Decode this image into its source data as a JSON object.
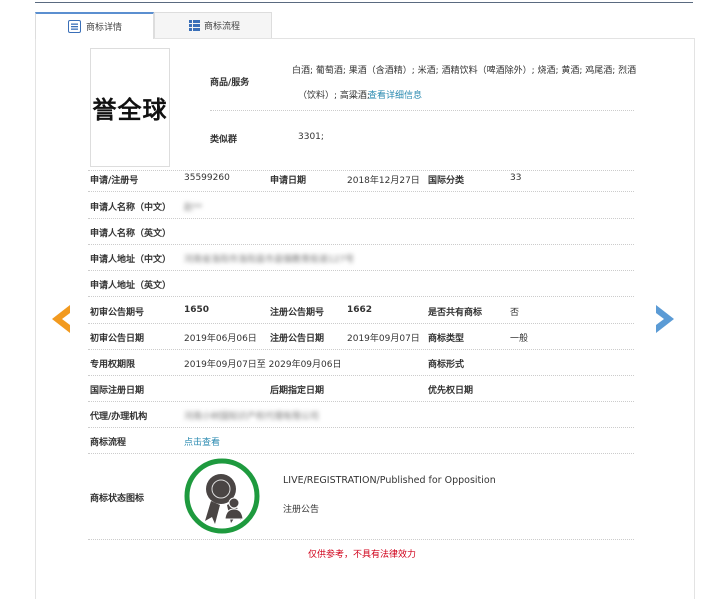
{
  "tabs": [
    {
      "label": "商标详情",
      "icon": "document-icon"
    },
    {
      "label": "商标流程",
      "icon": "list-icon"
    }
  ],
  "mark_text": "誉全球",
  "goods": {
    "label": "商品/服务",
    "line1": "白酒; 葡萄酒; 果酒（含酒精）; 米酒; 酒精饮料（啤酒除外）; 烧酒; 黄酒; 鸡尾酒; 烈酒",
    "line2": "（饮料）; 高粱酒;",
    "link": "查看详细信息"
  },
  "similar": {
    "label": "类似群",
    "value": "3301;"
  },
  "rows": {
    "reg_no": {
      "label": "申请/注册号",
      "value": "35599260"
    },
    "app_date": {
      "label": "申请日期",
      "value": "2018年12月27日"
    },
    "intl_class": {
      "label": "国际分类",
      "value": "33"
    },
    "applicant_cn": {
      "label": "申请人名称（中文）",
      "value": "赵**"
    },
    "applicant_en": {
      "label": "申请人名称（英文）"
    },
    "address_cn": {
      "label": "申请人地址（中文）",
      "value": "河南省洛阳市洛阳县市县镇教育街道127号"
    },
    "address_en": {
      "label": "申请人地址（英文）"
    },
    "prelim_no": {
      "label": "初审公告期号",
      "value": "1650"
    },
    "reg_pub_no": {
      "label": "注册公告期号",
      "value": "1662"
    },
    "shared": {
      "label": "是否共有商标",
      "value": "否"
    },
    "prelim_date": {
      "label": "初审公告日期",
      "value": "2019年06月06日"
    },
    "reg_pub_date": {
      "label": "注册公告日期",
      "value": "2019年09月07日"
    },
    "mark_type": {
      "label": "商标类型",
      "value": "一般"
    },
    "exclusive": {
      "label": "专用权期限",
      "value": "2019年09月07日至 2029年09月06日"
    },
    "mark_form": {
      "label": "商标形式"
    },
    "intl_reg_date": {
      "label": "国际注册日期"
    },
    "later_date": {
      "label": "后期指定日期"
    },
    "priority_date": {
      "label": "优先权日期"
    },
    "agent": {
      "label": "代理/办理机构",
      "value": "河南小树国知识产权代理有限公司"
    },
    "flow": {
      "label": "商标流程",
      "link": "点击查看"
    }
  },
  "status": {
    "label": "商标状态图标",
    "en": "LIVE/REGISTRATION/Published for Opposition",
    "cn": "注册公告",
    "icon": "award-ribbon-icon",
    "ring_color": "#1e9a3e"
  },
  "disclaimer": "仅供参考，不具有法律效力",
  "colors": {
    "prev_arrow": "#f29a1f",
    "next_arrow": "#5b9bd5",
    "disclaimer": "#d0021b",
    "link": "#2a8ab0"
  }
}
